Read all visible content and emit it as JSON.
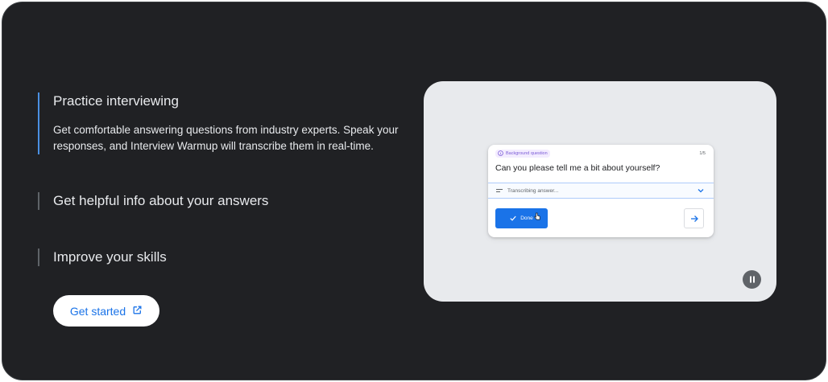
{
  "features": [
    {
      "title": "Practice interviewing",
      "description": "Get comfortable answering questions from industry experts. Speak your responses, and Interview Warmup will transcribe them in real-time."
    },
    {
      "title": "Get helpful info about your answers"
    },
    {
      "title": "Improve your skills"
    }
  ],
  "cta": {
    "label": "Get started",
    "icon": "open-in-new-icon"
  },
  "demo": {
    "question_tag": "Background question",
    "question_count": "1/5",
    "question": "Can you please tell me a bit about yourself?",
    "transcribing": "Transcribing answer...",
    "done_label": "Done",
    "icons": [
      "info-icon",
      "lines-icon",
      "chevron-down-icon",
      "check-icon",
      "cursor-hand-icon",
      "arrow-right-icon",
      "pause-icon"
    ]
  },
  "colors": {
    "background": "#202124",
    "accent": "#1a73e8",
    "active_indicator": "#4a90e2",
    "media_background": "#e8eaed"
  }
}
